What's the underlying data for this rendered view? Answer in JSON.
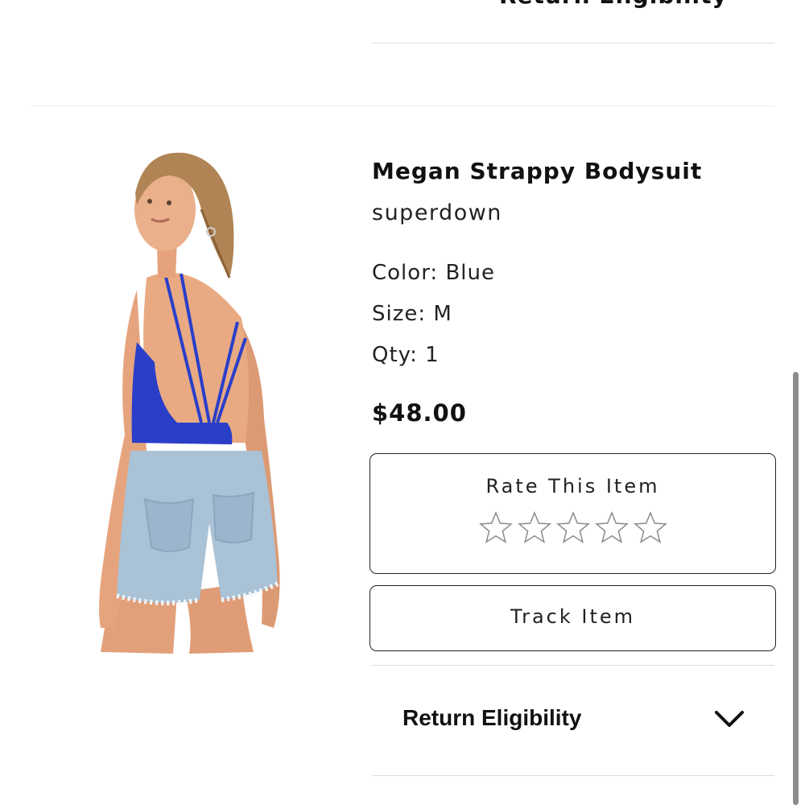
{
  "previous_item": {
    "cut_off_text": "Return Eligibility"
  },
  "product": {
    "name": "Megan Strappy Bodysuit",
    "brand": "superdown",
    "color": "Color: Blue",
    "size": "Size: M",
    "qty": "Qty: 1",
    "price": "$48.00"
  },
  "rating": {
    "title": "Rate This Item",
    "stars_count": 5
  },
  "actions": {
    "track_label": "Track Item"
  },
  "return_section": {
    "label": "Return Eligibility",
    "icon": "chevron-down-icon"
  },
  "colors": {
    "bodysuit": "#2a3fc9",
    "denim": "#a9c2d6",
    "skin": "#e8a47c",
    "hair": "#b08454",
    "border": "#222222"
  }
}
